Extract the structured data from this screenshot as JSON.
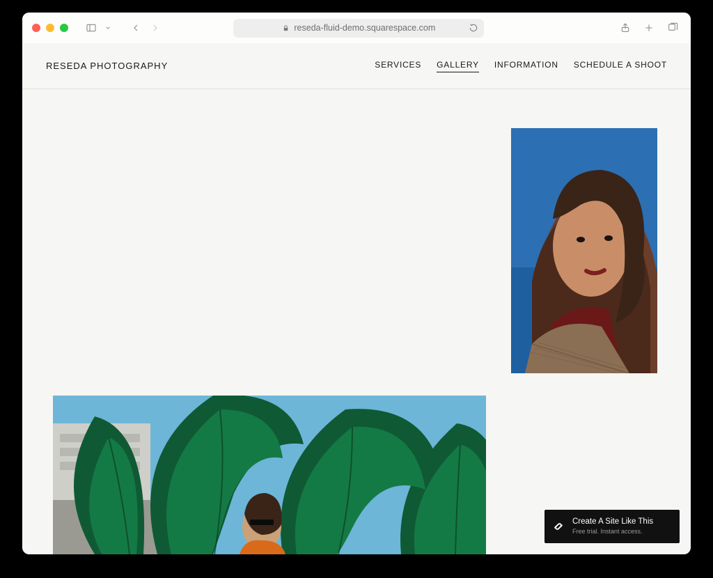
{
  "browser": {
    "url": "reseda-fluid-demo.squarespace.com"
  },
  "site": {
    "brand": "RESEDA PHOTOGRAPHY",
    "nav": {
      "services": "SERVICES",
      "gallery": "GALLERY",
      "information": "INFORMATION",
      "schedule": "SCHEDULE A SHOOT"
    }
  },
  "promo": {
    "line1": "Create A Site Like This",
    "line2": "Free trial. Instant access."
  }
}
